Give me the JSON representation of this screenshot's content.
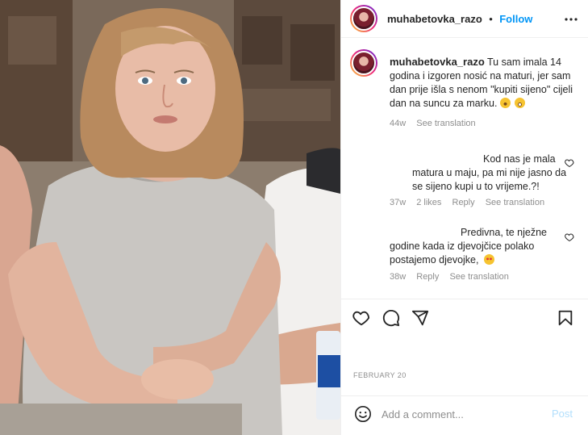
{
  "post": {
    "username": "muhabetovka_razo",
    "separator": "•",
    "follow_label": "Follow",
    "date": "FEBRUARY 20"
  },
  "caption": {
    "username": "muhabetovka_razo",
    "text": "Tu sam imala 14 godina i izgoren nosić na maturi, jer sam dan prije išla s nenom \"kupiti sijeno\" cijeli dan na suncu za marku.",
    "emoji_names": [
      "grinning-face",
      "grinning-squinting-face"
    ],
    "time": "44w",
    "translate": "See translation"
  },
  "comments": [
    {
      "text": "Kod nas je mala matura u maju, pa mi nije jasno da se sijeno kupi u to vrijeme.?!",
      "time": "37w",
      "likes": "2 likes",
      "reply": "Reply",
      "translate": "See translation"
    },
    {
      "text": "Predivna, te nježne godine kada iz djevojčice polako postajemo djevojke,",
      "emoji_name": "smiling-face-with-heart-eyes",
      "time": "38w",
      "reply": "Reply",
      "translate": "See translation"
    }
  ],
  "comment_box": {
    "placeholder": "Add a comment...",
    "post_label": "Post"
  },
  "colors": {
    "accent": "#0095f6",
    "post_disabled": "#b2dffc",
    "muted": "#8e8e8e"
  },
  "icons": [
    "more-icon",
    "heart-icon",
    "comment-icon",
    "share-icon",
    "bookmark-icon",
    "emoji-icon"
  ]
}
